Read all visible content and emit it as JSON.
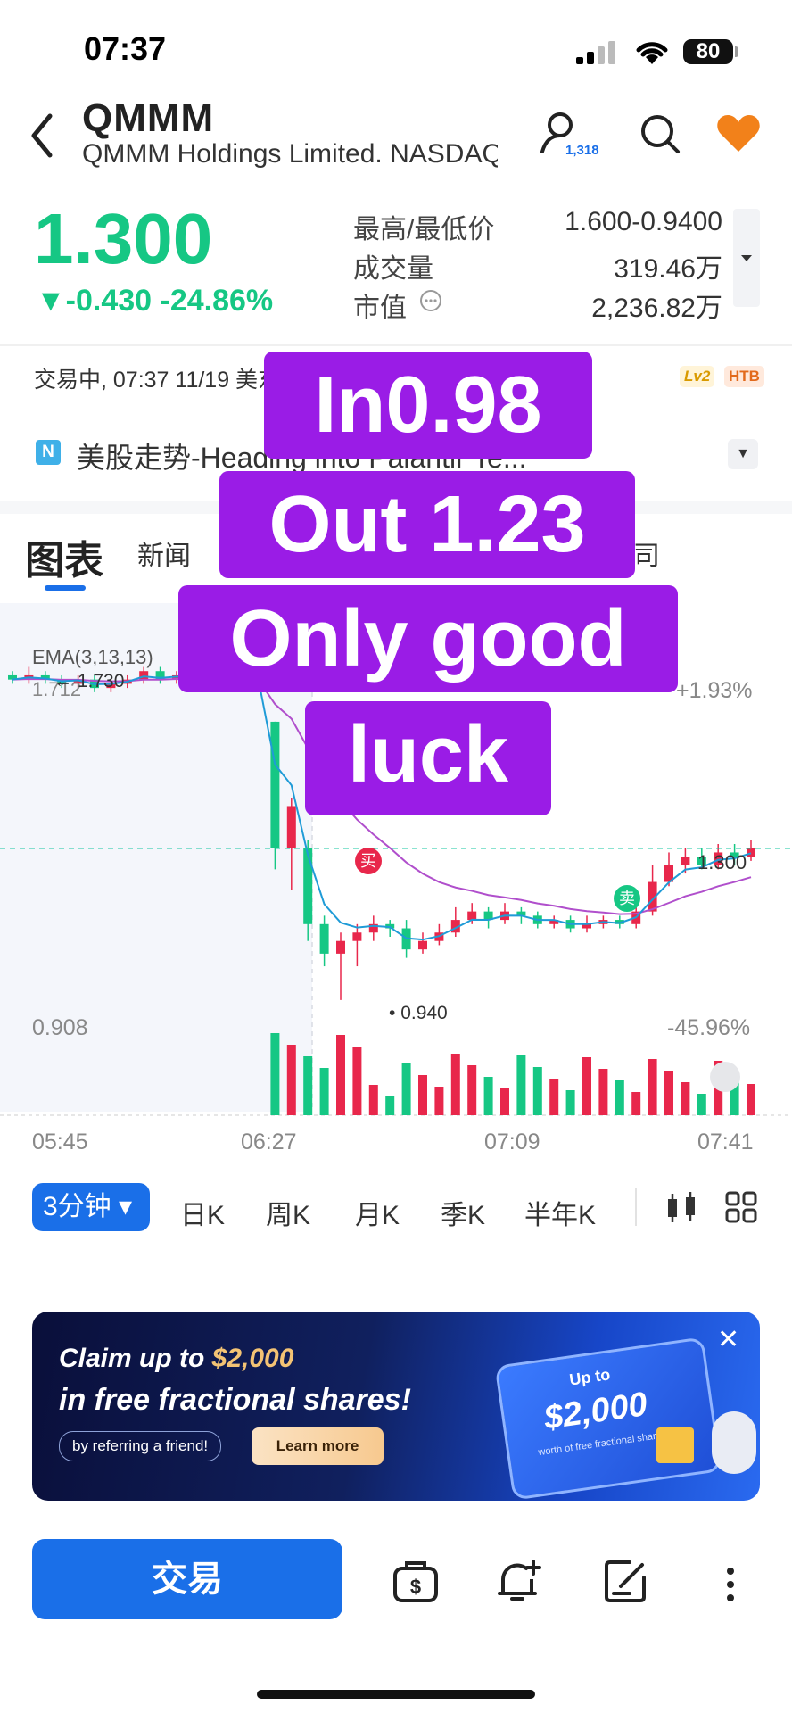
{
  "status_bar": {
    "time": "07:37",
    "battery": "80"
  },
  "header": {
    "ticker": "QMMM",
    "company": "QMMM Holdings Limited. NASDAQ",
    "follower_count": "1,318"
  },
  "quote": {
    "price": "1.300",
    "change": "-0.430 -24.86%",
    "stats": [
      {
        "label": "最高/最低价",
        "value": "1.600-0.9400"
      },
      {
        "label": "成交量",
        "value": "319.46万"
      },
      {
        "label": "市值",
        "value": "2,236.82万"
      }
    ],
    "trading_status": "交易中, 07:37 11/19 美东",
    "badges": [
      "Lv2",
      "HTB"
    ]
  },
  "news_banner": {
    "icon": "N",
    "text": "美股走势-Heading into Palantir Te..."
  },
  "tabs": {
    "chart": "图表",
    "news": "新闻",
    "company": "公司"
  },
  "chart": {
    "indicator": "EMA(3,13,13)",
    "top_left_value": "1.712",
    "top_right_pct": "+1.93%",
    "bottom_left_value": "0.908",
    "bottom_right_pct": "-45.96%",
    "high_marker": "1.730",
    "low_marker": "0.940",
    "current_price_label": "1.300",
    "buy_marker": "买",
    "sell_marker": "卖",
    "time_labels": [
      "05:45",
      "06:27",
      "07:09",
      "07:41"
    ]
  },
  "chart_data": {
    "type": "candlestick",
    "title": "",
    "x_labels": [
      "05:45",
      "06:27",
      "07:09",
      "07:41"
    ],
    "ylim": [
      0.908,
      1.712
    ],
    "high": 1.73,
    "low": 0.94,
    "last": 1.3,
    "y_right_pct": [
      "+1.93%",
      "-45.96%"
    ],
    "candles": [
      {
        "o": 1.71,
        "c": 1.7,
        "h": 1.72,
        "l": 1.69
      },
      {
        "o": 1.7,
        "c": 1.71,
        "h": 1.73,
        "l": 1.69
      },
      {
        "o": 1.71,
        "c": 1.7,
        "h": 1.72,
        "l": 1.69
      },
      {
        "o": 1.7,
        "c": 1.69,
        "h": 1.71,
        "l": 1.68
      },
      {
        "o": 1.69,
        "c": 1.7,
        "h": 1.71,
        "l": 1.68
      },
      {
        "o": 1.7,
        "c": 1.68,
        "h": 1.71,
        "l": 1.67
      },
      {
        "o": 1.68,
        "c": 1.69,
        "h": 1.7,
        "l": 1.67
      },
      {
        "o": 1.69,
        "c": 1.7,
        "h": 1.71,
        "l": 1.68
      },
      {
        "o": 1.7,
        "c": 1.72,
        "h": 1.73,
        "l": 1.69
      },
      {
        "o": 1.72,
        "c": 1.7,
        "h": 1.73,
        "l": 1.69
      },
      {
        "o": 1.7,
        "c": 1.71,
        "h": 1.72,
        "l": 1.69
      },
      {
        "o": 1.71,
        "c": 1.7,
        "h": 1.72,
        "l": 1.69
      },
      {
        "o": 1.7,
        "c": 1.69,
        "h": 1.71,
        "l": 1.68
      },
      {
        "o": 1.69,
        "c": 1.7,
        "h": 1.71,
        "l": 1.68
      },
      {
        "o": 1.7,
        "c": 1.69,
        "h": 1.7,
        "l": 1.68
      },
      {
        "o": 1.69,
        "c": 1.7,
        "h": 1.71,
        "l": 1.68
      },
      {
        "o": 1.6,
        "c": 1.3,
        "h": 1.6,
        "l": 1.25
      },
      {
        "o": 1.3,
        "c": 1.4,
        "h": 1.42,
        "l": 1.2
      },
      {
        "o": 1.3,
        "c": 1.12,
        "h": 1.32,
        "l": 1.08
      },
      {
        "o": 1.12,
        "c": 1.05,
        "h": 1.14,
        "l": 1.02
      },
      {
        "o": 1.05,
        "c": 1.08,
        "h": 1.1,
        "l": 0.94
      },
      {
        "o": 1.08,
        "c": 1.1,
        "h": 1.12,
        "l": 1.02
      },
      {
        "o": 1.1,
        "c": 1.12,
        "h": 1.14,
        "l": 1.08
      },
      {
        "o": 1.12,
        "c": 1.11,
        "h": 1.13,
        "l": 1.09
      },
      {
        "o": 1.11,
        "c": 1.06,
        "h": 1.13,
        "l": 1.04
      },
      {
        "o": 1.06,
        "c": 1.08,
        "h": 1.1,
        "l": 1.05
      },
      {
        "o": 1.08,
        "c": 1.1,
        "h": 1.12,
        "l": 1.07
      },
      {
        "o": 1.1,
        "c": 1.13,
        "h": 1.16,
        "l": 1.09
      },
      {
        "o": 1.13,
        "c": 1.15,
        "h": 1.17,
        "l": 1.12
      },
      {
        "o": 1.15,
        "c": 1.13,
        "h": 1.16,
        "l": 1.11
      },
      {
        "o": 1.13,
        "c": 1.15,
        "h": 1.17,
        "l": 1.12
      },
      {
        "o": 1.15,
        "c": 1.14,
        "h": 1.16,
        "l": 1.12
      },
      {
        "o": 1.14,
        "c": 1.12,
        "h": 1.15,
        "l": 1.11
      },
      {
        "o": 1.12,
        "c": 1.13,
        "h": 1.14,
        "l": 1.11
      },
      {
        "o": 1.13,
        "c": 1.11,
        "h": 1.14,
        "l": 1.1
      },
      {
        "o": 1.11,
        "c": 1.12,
        "h": 1.14,
        "l": 1.1
      },
      {
        "o": 1.12,
        "c": 1.13,
        "h": 1.14,
        "l": 1.11
      },
      {
        "o": 1.13,
        "c": 1.12,
        "h": 1.14,
        "l": 1.11
      },
      {
        "o": 1.12,
        "c": 1.15,
        "h": 1.17,
        "l": 1.11
      },
      {
        "o": 1.15,
        "c": 1.22,
        "h": 1.26,
        "l": 1.14
      },
      {
        "o": 1.22,
        "c": 1.26,
        "h": 1.29,
        "l": 1.21
      },
      {
        "o": 1.26,
        "c": 1.28,
        "h": 1.3,
        "l": 1.24
      },
      {
        "o": 1.28,
        "c": 1.26,
        "h": 1.3,
        "l": 1.25
      },
      {
        "o": 1.26,
        "c": 1.29,
        "h": 1.31,
        "l": 1.25
      },
      {
        "o": 1.29,
        "c": 1.28,
        "h": 1.31,
        "l": 1.26
      },
      {
        "o": 1.28,
        "c": 1.3,
        "h": 1.32,
        "l": 1.27
      }
    ]
  },
  "intervals": [
    "3分钟",
    "日K",
    "周K",
    "月K",
    "季K",
    "半年K"
  ],
  "promo": {
    "line1_prefix": "Claim up to ",
    "line1_amount": "$2,000",
    "line2": "in free fractional shares!",
    "referral": "by referring a friend!",
    "button": "Learn more",
    "card_upto": "Up to",
    "card_amount": "$2,000",
    "card_sub": "worth of free fractional shares"
  },
  "bottom_bar": {
    "trade_label": "交易"
  },
  "overlay": {
    "lines": [
      "In0.98",
      "Out 1.23",
      "Only good",
      "luck"
    ]
  },
  "colors": {
    "up": "#16c784",
    "down": "#e8274b",
    "accent": "#1a6fe8",
    "overlay": "#9a1ce6"
  }
}
